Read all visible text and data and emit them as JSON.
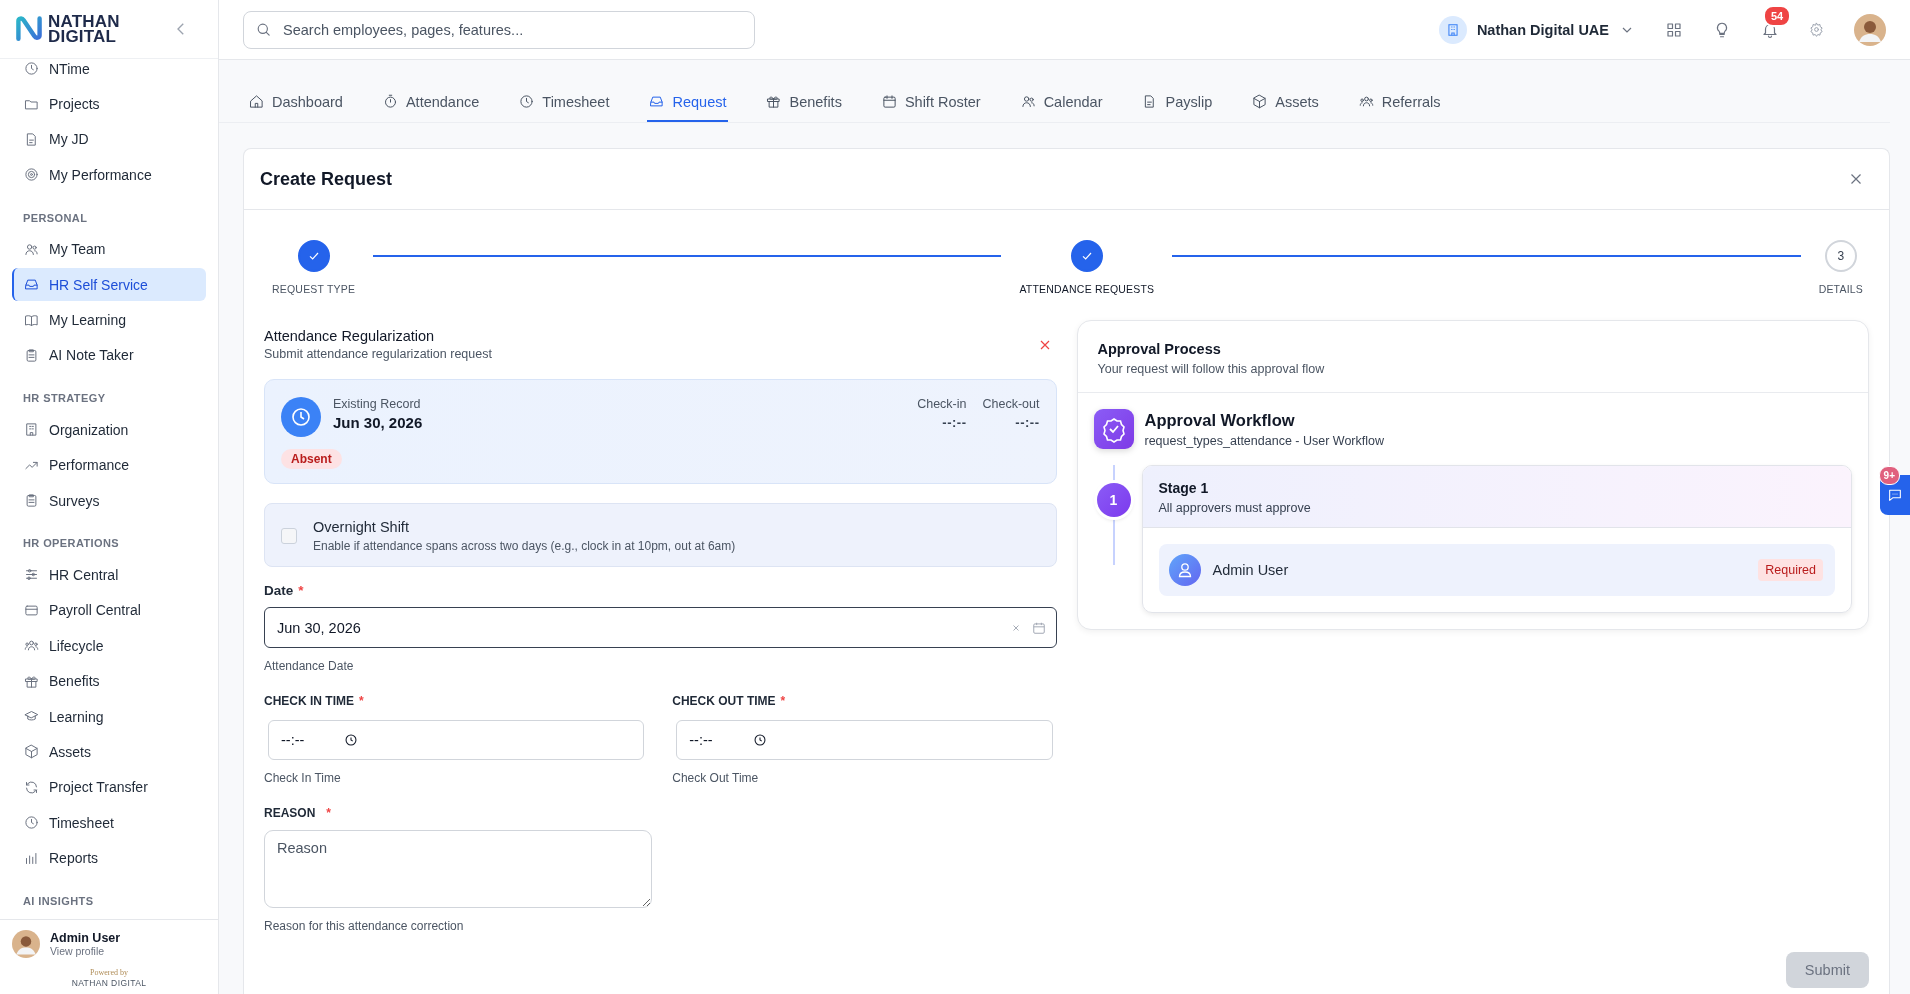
{
  "logo": {
    "line1": "NATHAN",
    "line2": "DIGITAL"
  },
  "sidebar": {
    "sections": [
      {
        "items": [
          {
            "label": "NTime",
            "selected": false
          },
          {
            "label": "Projects",
            "selected": false
          },
          {
            "label": "My JD",
            "selected": false
          },
          {
            "label": "My Performance",
            "selected": false
          }
        ]
      },
      {
        "title": "PERSONAL",
        "items": [
          {
            "label": "My Team",
            "selected": false
          },
          {
            "label": "HR Self Service",
            "selected": true
          },
          {
            "label": "My Learning",
            "selected": false
          },
          {
            "label": "AI Note Taker",
            "selected": false
          }
        ]
      },
      {
        "title": "HR STRATEGY",
        "items": [
          {
            "label": "Organization",
            "selected": false
          },
          {
            "label": "Performance",
            "selected": false
          },
          {
            "label": "Surveys",
            "selected": false
          }
        ]
      },
      {
        "title": "HR OPERATIONS",
        "items": [
          {
            "label": "HR Central",
            "selected": false
          },
          {
            "label": "Payroll Central",
            "selected": false
          },
          {
            "label": "Lifecycle",
            "selected": false
          },
          {
            "label": "Benefits",
            "selected": false
          },
          {
            "label": "Learning",
            "selected": false
          },
          {
            "label": "Assets",
            "selected": false
          },
          {
            "label": "Project Transfer",
            "selected": false
          },
          {
            "label": "Timesheet",
            "selected": false
          },
          {
            "label": "Reports",
            "selected": false
          }
        ]
      },
      {
        "title": "AI INSIGHTS"
      }
    ],
    "user": {
      "name": "Admin User",
      "link": "View profile"
    },
    "powered": {
      "caption": "Powered by",
      "brand": "NATHAN DIGITAL"
    }
  },
  "topbar": {
    "search": {
      "placeholder": "Search employees, pages, features..."
    },
    "company": "Nathan Digital UAE",
    "notifications": "54"
  },
  "tabs": [
    {
      "label": "Dashboard",
      "selected": false
    },
    {
      "label": "Attendance",
      "selected": false
    },
    {
      "label": "Timesheet",
      "selected": false
    },
    {
      "label": "Request",
      "selected": true
    },
    {
      "label": "Benefits",
      "selected": false
    },
    {
      "label": "Shift Roster",
      "selected": false
    },
    {
      "label": "Calendar",
      "selected": false
    },
    {
      "label": "Payslip",
      "selected": false
    },
    {
      "label": "Assets",
      "selected": false
    },
    {
      "label": "Referrals",
      "selected": false
    }
  ],
  "card": {
    "title": "Create Request"
  },
  "steps": [
    {
      "label": "REQUEST TYPE",
      "completed": true,
      "selected": false
    },
    {
      "label": "ATTENDANCE REQUESTS",
      "completed": true,
      "selected": true
    },
    {
      "label": "DETAILS",
      "number": "3",
      "completed": false,
      "selected": false
    }
  ],
  "form": {
    "title": "Attendance Regularization",
    "subtitle": "Submit attendance regularization request",
    "record": {
      "label": "Existing Record",
      "date": "Jun 30, 2026",
      "check_in_label": "Check-in",
      "check_in": "--:--",
      "check_out_label": "Check-out",
      "check_out": "--:--",
      "status": "Absent"
    },
    "overnight": {
      "title": "Overnight Shift",
      "description": "Enable if attendance spans across two days (e.g., clock in at 10pm, out at 6am)",
      "checked": false
    },
    "date": {
      "label": "Date",
      "required_mark": "*",
      "value": "Jun 30, 2026",
      "helper": "Attendance Date"
    },
    "check_in": {
      "label": "CHECK IN TIME",
      "required_mark": "*",
      "value": "--:--",
      "helper": "Check In Time"
    },
    "check_out": {
      "label": "CHECK OUT TIME",
      "required_mark": "*",
      "value": "--:--",
      "helper": "Check Out Time"
    },
    "reason": {
      "label": "REASON",
      "required_mark": "*",
      "placeholder": "Reason",
      "helper": "Reason for this attendance correction"
    }
  },
  "approval": {
    "title": "Approval Process",
    "subtitle": "Your request will follow this approval flow",
    "workflow_title": "Approval Workflow",
    "workflow_subtitle": "request_types_attendance - User Workflow",
    "stages": [
      {
        "number": "1",
        "title": "Stage 1",
        "subtitle": "All approvers must approve",
        "approvers": [
          {
            "name": "Admin User",
            "badge": "Required"
          }
        ]
      }
    ]
  },
  "submit": {
    "label": "Submit",
    "disabled": true
  },
  "chat": {
    "badge": "9+"
  }
}
